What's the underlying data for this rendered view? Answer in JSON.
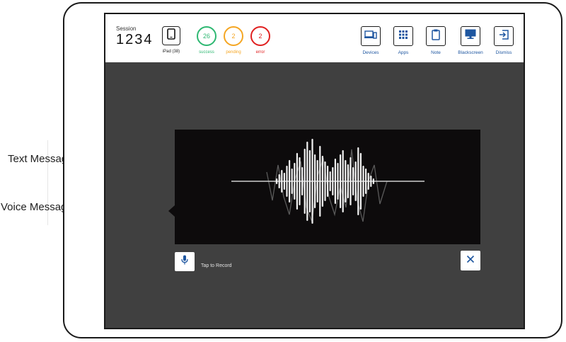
{
  "header": {
    "session_label": "Session",
    "session_number": "1234",
    "device_label": "iPad (38)"
  },
  "stats": [
    {
      "value": "26",
      "label": "success",
      "color": "#2eb872"
    },
    {
      "value": "2",
      "label": "pending",
      "color": "#f5a623"
    },
    {
      "value": "2",
      "label": "error",
      "color": "#e02020"
    }
  ],
  "toolbar": [
    {
      "label": "Devices",
      "icon": "devices-icon"
    },
    {
      "label": "Apps",
      "icon": "apps-grid-icon"
    },
    {
      "label": "Note",
      "icon": "clipboard-icon"
    },
    {
      "label": "Blackscreen",
      "icon": "monitor-icon"
    },
    {
      "label": "Dismiss",
      "icon": "exit-icon"
    }
  ],
  "recorder": {
    "tap_label": "Tap to Record",
    "record_icon": "microphone-icon",
    "close_icon": "close-icon"
  },
  "callouts": {
    "text_message": "Text Message",
    "voice_message": "Voice Message"
  },
  "colors": {
    "accent": "#1e56a0",
    "callout": "#e53935",
    "screen_bg": "#404040",
    "wave_bg": "#0d0b0c"
  }
}
